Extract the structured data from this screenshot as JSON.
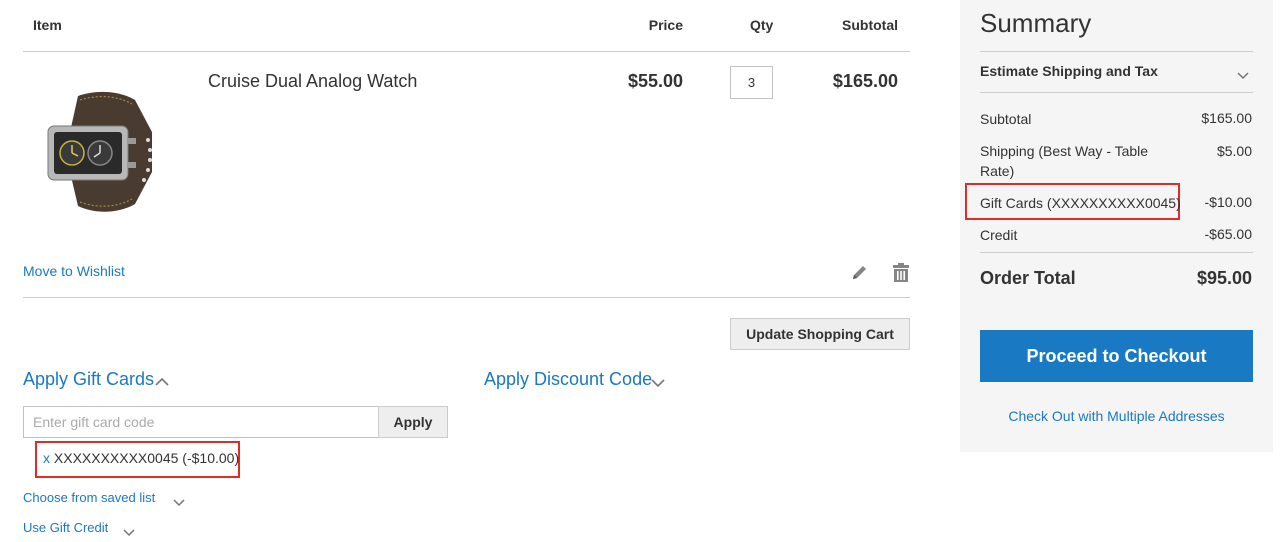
{
  "cart": {
    "headers": {
      "item": "Item",
      "price": "Price",
      "qty": "Qty",
      "subtotal": "Subtotal"
    },
    "item": {
      "name": "Cruise Dual Analog Watch",
      "price": "$55.00",
      "qty": "3",
      "subtotal": "$165.00",
      "move_to_wishlist": "Move to Wishlist",
      "edit_icon": "pencil-icon",
      "delete_icon": "trash-icon"
    },
    "update_button": "Update Shopping Cart"
  },
  "gift_cards": {
    "title": "Apply Gift Cards",
    "input_placeholder": "Enter gift card code",
    "input_value": "",
    "apply_button": "Apply",
    "applied_remove": "x",
    "applied_card": "XXXXXXXXXX0045 (-$10.00)",
    "saved_list_link": "Choose from saved list",
    "gift_credit_link": "Use Gift Credit"
  },
  "discount": {
    "title": "Apply Discount Code"
  },
  "summary": {
    "title": "Summary",
    "estimate": "Estimate Shipping and Tax",
    "rows": [
      {
        "label": "Subtotal",
        "value": "$165.00"
      },
      {
        "label": "Shipping (Best Way - Table Rate)",
        "value": "$5.00"
      },
      {
        "label": "Gift Cards (XXXXXXXXXX0045)",
        "value": "-$10.00"
      },
      {
        "label": "Credit",
        "value": "-$65.00"
      }
    ],
    "order_total_label": "Order Total",
    "order_total_value": "$95.00",
    "checkout_button": "Proceed to Checkout",
    "multi_address_link": "Check Out with Multiple Addresses"
  },
  "colors": {
    "link": "#1979c3",
    "primary": "#1979c3",
    "highlight": "#e02b27",
    "summary_bg": "#f5f5f5"
  }
}
